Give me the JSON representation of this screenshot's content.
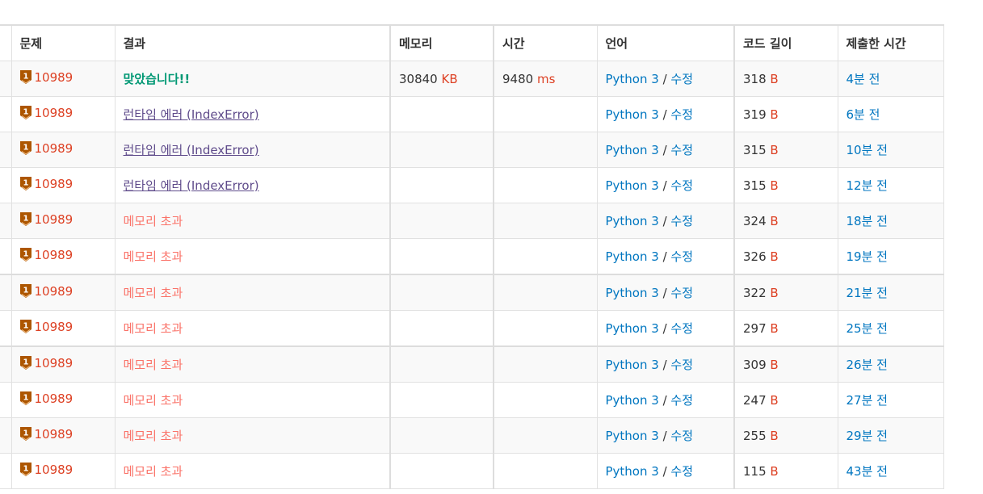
{
  "headers": [
    "문제",
    "결과",
    "메모리",
    "시간",
    "언어",
    "코드 길이",
    "제출한 시간"
  ],
  "units": {
    "memory": "KB",
    "time": "ms",
    "length": "B"
  },
  "rows": [
    {
      "problem": "10989",
      "result": "맞았습니다!!",
      "result_type": "ac",
      "memory": "30840",
      "time": "9480",
      "language": "Python 3",
      "edit": "수정",
      "length": "318",
      "submitted": "4분 전"
    },
    {
      "problem": "10989",
      "result": "런타임 에러 (IndexError)",
      "result_type": "re",
      "memory": "",
      "time": "",
      "language": "Python 3",
      "edit": "수정",
      "length": "319",
      "submitted": "6분 전"
    },
    {
      "problem": "10989",
      "result": "런타임 에러 (IndexError)",
      "result_type": "re",
      "memory": "",
      "time": "",
      "language": "Python 3",
      "edit": "수정",
      "length": "315",
      "submitted": "10분 전"
    },
    {
      "problem": "10989",
      "result": "런타임 에러 (IndexError)",
      "result_type": "re",
      "memory": "",
      "time": "",
      "language": "Python 3",
      "edit": "수정",
      "length": "315",
      "submitted": "12분 전"
    },
    {
      "problem": "10989",
      "result": "메모리 초과",
      "result_type": "mle",
      "memory": "",
      "time": "",
      "language": "Python 3",
      "edit": "수정",
      "length": "324",
      "submitted": "18분 전"
    },
    {
      "problem": "10989",
      "result": "메모리 초과",
      "result_type": "mle",
      "memory": "",
      "time": "",
      "language": "Python 3",
      "edit": "수정",
      "length": "326",
      "submitted": "19분 전"
    },
    {
      "problem": "10989",
      "result": "메모리 초과",
      "result_type": "mle",
      "memory": "",
      "time": "",
      "language": "Python 3",
      "edit": "수정",
      "length": "322",
      "submitted": "21분 전"
    },
    {
      "problem": "10989",
      "result": "메모리 초과",
      "result_type": "mle",
      "memory": "",
      "time": "",
      "language": "Python 3",
      "edit": "수정",
      "length": "297",
      "submitted": "25분 전"
    },
    {
      "problem": "10989",
      "result": "메모리 초과",
      "result_type": "mle",
      "memory": "",
      "time": "",
      "language": "Python 3",
      "edit": "수정",
      "length": "309",
      "submitted": "26분 전"
    },
    {
      "problem": "10989",
      "result": "메모리 초과",
      "result_type": "mle",
      "memory": "",
      "time": "",
      "language": "Python 3",
      "edit": "수정",
      "length": "247",
      "submitted": "27분 전"
    },
    {
      "problem": "10989",
      "result": "메모리 초과",
      "result_type": "mle",
      "memory": "",
      "time": "",
      "language": "Python 3",
      "edit": "수정",
      "length": "255",
      "submitted": "29분 전"
    },
    {
      "problem": "10989",
      "result": "메모리 초과",
      "result_type": "mle",
      "memory": "",
      "time": "",
      "language": "Python 3",
      "edit": "수정",
      "length": "115",
      "submitted": "43분 전"
    }
  ],
  "colors": {
    "ac": "#009874",
    "re": "#5f4b8b",
    "mle": "#fa7268",
    "link": "#0076c0",
    "unit": "#dd4124",
    "tier": "#ad5600"
  },
  "icons": {
    "tier": "bronze-tier-1-icon"
  }
}
